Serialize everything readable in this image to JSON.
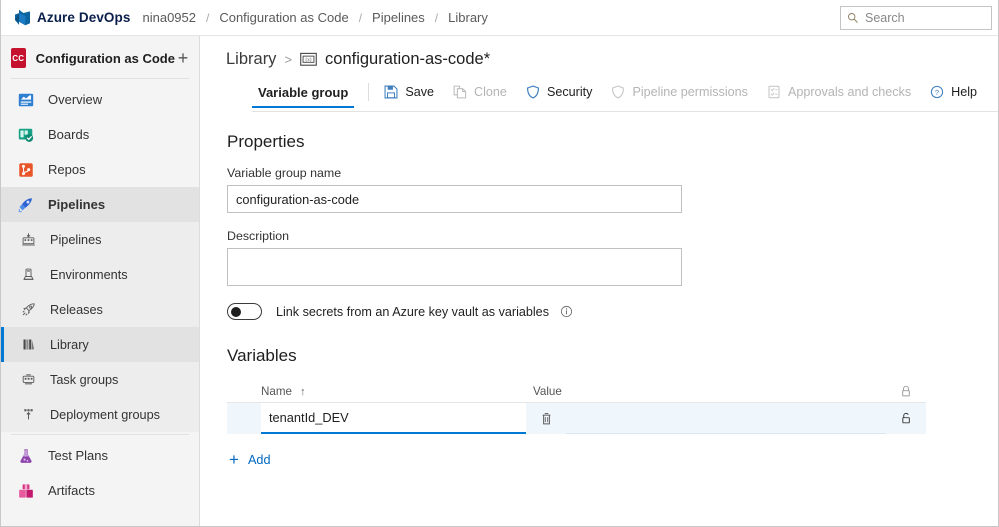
{
  "topbar": {
    "logo_icon": "azure-devops-logo",
    "brand": "Azure DevOps",
    "breadcrumbs": [
      {
        "label": "nina0952"
      },
      {
        "label": "Configuration as Code"
      },
      {
        "label": "Pipelines"
      },
      {
        "label": "Library"
      }
    ],
    "separator": "/",
    "search": {
      "icon": "search-icon",
      "placeholder": "Search",
      "value": ""
    }
  },
  "sidebar": {
    "project": {
      "avatar_text": "CC",
      "avatar_color": "#c4122f",
      "name": "Configuration as Code",
      "add_icon": "plus-icon"
    },
    "items": [
      {
        "label": "Overview",
        "icon": "overview-icon",
        "state": "normal"
      },
      {
        "label": "Boards",
        "icon": "boards-icon",
        "state": "normal"
      },
      {
        "label": "Repos",
        "icon": "repos-icon",
        "state": "normal"
      },
      {
        "label": "Pipelines",
        "icon": "pipelines-icon",
        "state": "group-active"
      },
      {
        "label": "Pipelines",
        "icon": "pipelines-sub-icon",
        "state": "sub"
      },
      {
        "label": "Environments",
        "icon": "environments-icon",
        "state": "sub"
      },
      {
        "label": "Releases",
        "icon": "releases-icon",
        "state": "sub"
      },
      {
        "label": "Library",
        "icon": "library-icon",
        "state": "sub-active"
      },
      {
        "label": "Task groups",
        "icon": "task-groups-icon",
        "state": "sub"
      },
      {
        "label": "Deployment groups",
        "icon": "deployment-groups-icon",
        "state": "sub"
      },
      {
        "label": "Test Plans",
        "icon": "test-plans-icon",
        "state": "normal"
      },
      {
        "label": "Artifacts",
        "icon": "artifacts-icon",
        "state": "normal"
      }
    ],
    "accent_color": "#0078d4"
  },
  "page": {
    "breadcrumb_root": "Library",
    "breadcrumb_sep": ">",
    "variable_group_icon": "variable-group-icon",
    "title": "configuration-as-code*"
  },
  "toolbar": {
    "tab_label": "Variable group",
    "buttons": [
      {
        "label": "Save",
        "icon": "save-icon",
        "disabled": false
      },
      {
        "label": "Clone",
        "icon": "clone-icon",
        "disabled": true
      },
      {
        "label": "Security",
        "icon": "shield-icon",
        "disabled": false
      },
      {
        "label": "Pipeline permissions",
        "icon": "shield-outline-icon",
        "disabled": true
      },
      {
        "label": "Approvals and checks",
        "icon": "checklist-icon",
        "disabled": true
      },
      {
        "label": "Help",
        "icon": "help-icon",
        "disabled": false
      }
    ]
  },
  "properties": {
    "section_title": "Properties",
    "name_label": "Variable group name",
    "name_value": "configuration-as-code",
    "name_placeholder": "",
    "description_label": "Description",
    "description_value": "",
    "description_placeholder": "",
    "keyvault_toggle": {
      "state": "off",
      "label": "Link secrets from an Azure key vault as variables",
      "info_icon": "info-icon"
    }
  },
  "variables": {
    "section_title": "Variables",
    "columns": [
      {
        "key": "name",
        "label": "Name",
        "sort": "↑"
      },
      {
        "key": "value",
        "label": "Value",
        "sort": ""
      },
      {
        "key": "lock",
        "label": "",
        "icon": "lock-closed-icon"
      }
    ],
    "rows": [
      {
        "name": "tenantId_DEV",
        "name_placeholder": "",
        "value": "",
        "value_placeholder": "",
        "delete_icon": "trash-icon",
        "lock_icon": "lock-open-icon",
        "focused": true
      }
    ],
    "add": {
      "label": "Add",
      "icon": "plus-icon"
    }
  },
  "colors": {
    "accent": "#0078d4",
    "link": "#0069c0",
    "row_highlight": "#eff6fc",
    "sidebar_bg": "#f4f4f4",
    "sidebar_active": "#e2e2e2"
  }
}
